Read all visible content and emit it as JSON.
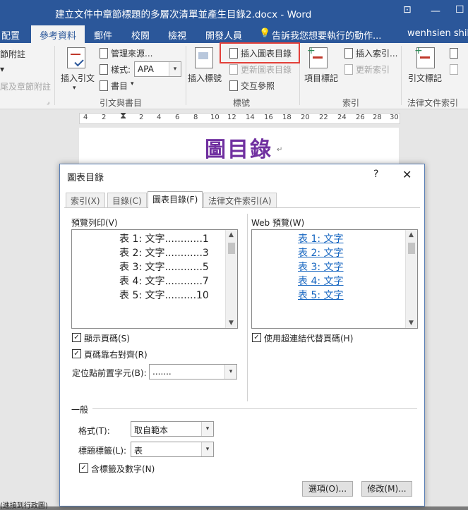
{
  "window": {
    "title": "建立文件中章節標題的多層次清單並產生目錄2.docx - Word",
    "restore_glyph": "⊡",
    "minimize_glyph": "—",
    "maximize_glyph": "☐"
  },
  "ribbon_tabs": {
    "layout_partial": "配置",
    "references": "參考資料",
    "mailings": "郵件",
    "review": "校閱",
    "view": "檢視",
    "developer": "開發人員",
    "tell_me": "告訴我您想要執行的動作...",
    "user": "wenhsien shih"
  },
  "ribbon": {
    "footnotes": {
      "item1_partial": "節附註",
      "item2_partial": "▾",
      "item3_partial": "尾及章節附註"
    },
    "citations": {
      "insert_citation": "插入引文",
      "manage_sources": "管理來源...",
      "style_label": "樣式:",
      "style_value": "APA",
      "bibliography": "書目",
      "group_label": "引文與書目"
    },
    "captions": {
      "insert_caption": "插入標號",
      "insert_table_of_figures": "插入圖表目錄",
      "update_table": "更新圖表目錄",
      "cross_reference": "交互參照",
      "group_label": "標號"
    },
    "index": {
      "mark_entry": "項目標記",
      "insert_index": "插入索引...",
      "update_index": "更新索引",
      "group_label": "索引"
    },
    "table_of_authorities": {
      "mark_citation": "引文標記",
      "group_label": "法律文件索引"
    }
  },
  "ruler": {
    "numbers": [
      "4",
      "2",
      "2",
      "4",
      "6",
      "8",
      "10",
      "12",
      "14",
      "16",
      "18",
      "20",
      "22",
      "24",
      "26",
      "28",
      "30"
    ]
  },
  "document": {
    "heading": "圖目錄",
    "paragraph_mark": "↵"
  },
  "dialog": {
    "title": "圖表目錄",
    "help": "?",
    "close": "✕",
    "tabs": [
      "索引(X)",
      "目錄(C)",
      "圖表目錄(F)",
      "法律文件索引(A)"
    ],
    "active_tab": "圖表目錄(F)",
    "print_preview": {
      "label": "預覽列印(V)",
      "lines": [
        "表 1:  文字............1",
        "表 2:  文字............3",
        "表 3:  文字............5",
        "表 4:  文字............7",
        "表 5:  文字..........10"
      ]
    },
    "web_preview": {
      "label": "Web 預覽(W)",
      "lines": [
        "表 1:  文字",
        "表 2:  文字",
        "表 3:  文字",
        "表 4:  文字",
        "表 5:  文字"
      ]
    },
    "show_page_numbers": {
      "label": "顯示頁碼(S)",
      "checked": true
    },
    "right_align_page_numbers": {
      "label": "頁碼靠右對齊(R)",
      "checked": true
    },
    "tab_leader": {
      "label": "定位點前置字元(B):",
      "value": "......."
    },
    "use_hyperlinks": {
      "label": "使用超連結代替頁碼(H)",
      "checked": true
    },
    "general_label": "一般",
    "formats": {
      "label": "格式(T):",
      "value": "取自範本"
    },
    "caption_label": {
      "label": "標題標籤(L):",
      "value": "表"
    },
    "include_label_and_number": {
      "label": "含標籤及數字(N)",
      "checked": true
    },
    "options_button": "選項(O)...",
    "modify_button": "修改(M)..."
  },
  "statusbar": {
    "partial": "(進接到行政圖)"
  },
  "colors": {
    "titlebar": "#2b579a",
    "heading": "#7030a0",
    "hyperlink": "#1565c0",
    "highlight": "#e2403a"
  }
}
